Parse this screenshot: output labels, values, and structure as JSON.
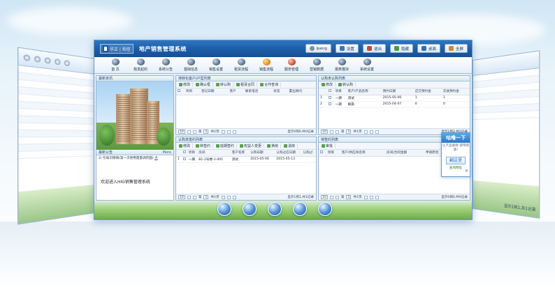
{
  "window": {
    "logo_text": "华正 | 和信",
    "title": "地产销售管理系统",
    "user_name": "lpeng",
    "buttons": [
      {
        "label": "设置"
      },
      {
        "label": "退出"
      },
      {
        "label": "隐藏"
      },
      {
        "label": "桌面"
      },
      {
        "label": "全屏"
      }
    ]
  },
  "nav": [
    {
      "label": "首 页"
    },
    {
      "label": "我发起的"
    },
    {
      "label": "系统公告"
    },
    {
      "label": "基础信息"
    },
    {
      "label": "销售设置"
    },
    {
      "label": "租赁流程"
    },
    {
      "label": "销售流程"
    },
    {
      "label": "服务管理"
    },
    {
      "label": "营销数据"
    },
    {
      "label": "报表模块"
    },
    {
      "label": "系统设置"
    }
  ],
  "news": {
    "header": "最新资讯",
    "more": "More",
    "notice_header": "最新公告",
    "items": [
      {
        "text": "2) 引知识情情(第一次更用量量调页面)",
        "link": "点"
      }
    ],
    "welcome": "欢迎进入HIG销售管理系统"
  },
  "panel_pending": {
    "header": "待转化客户/户型列表",
    "tools": [
      "修改",
      "确认框",
      "转认购",
      "租赁合同",
      "合作查询"
    ],
    "columns": [
      "",
      "项目",
      "登记日期",
      "客户",
      "联系电话",
      "状态",
      "置业顾问"
    ],
    "rows": [],
    "pager": {
      "page_size": "10",
      "page_label": "第",
      "page": "1",
      "total": "共1页",
      "info": "显示0到0,共0记录"
    }
  },
  "panel_unconfirmed": {
    "header": "认购未认购列表",
    "tools": [
      "修改",
      "转认购"
    ],
    "columns": [
      "",
      "项目",
      "客户/产品名称",
      "预约日期",
      "应交预约金",
      "实收预约金"
    ],
    "rows": [
      {
        "no": "1",
        "project": "一期",
        "name": "测试",
        "date": "2015-05-06",
        "due": "1",
        "paid": "1"
      },
      {
        "no": "2",
        "project": "一期",
        "name": "解震",
        "date": "2015-04-07",
        "due": "0",
        "paid": "0"
      }
    ],
    "pager": {
      "page_size": "10",
      "page_label": "第",
      "page": "1",
      "total": "共1页",
      "info": "显示1到2,共2记录"
    }
  },
  "panel_subscribe": {
    "header": "认购未签约列表",
    "tools": [
      "修改",
      "转签约",
      "延期签约",
      "权益人变更",
      "换房",
      "退房"
    ],
    "columns": [
      "",
      "项目",
      "房间",
      "客户名称",
      "认购日期",
      "认购过应日期",
      "认购过"
    ],
    "rows": [
      {
        "no": "1",
        "project": "一期",
        "room": "B1-2号楼-1-401",
        "name": "测试",
        "date": "2015-05-06",
        "due": "2015-05-13"
      }
    ],
    "pager": {
      "page_size": "10",
      "page_label": "第",
      "page": "1",
      "total": "共1页",
      "info": "显示1到1,共1记录"
    }
  },
  "panel_sign": {
    "header": "待签约列表",
    "tools": [
      "审批"
    ],
    "columns": [
      "",
      "项目",
      "客户/供应商名称",
      "房间/合同金额",
      "申请原因",
      "申请人"
    ],
    "rows": [],
    "pager": {
      "page_size": "10",
      "page_label": "第",
      "page": "1",
      "total": "共1页",
      "info": "显示0到0,共0记录"
    }
  },
  "float_ad": {
    "title": "咕噜一下",
    "subtitle": "让产品收款 即带惊喜!",
    "button": "翻这里",
    "footer": "查询网址"
  },
  "side_right": {
    "pager_info": "显示1到1,共1记录"
  },
  "colors": {
    "titlebar": "#1d5ea8",
    "accent": "#2257a8"
  }
}
